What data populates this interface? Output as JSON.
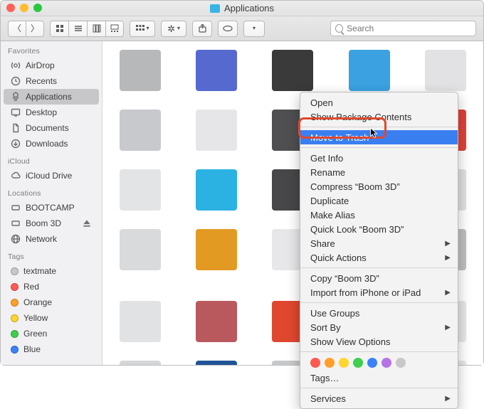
{
  "window": {
    "title": "Applications"
  },
  "search": {
    "placeholder": "Search"
  },
  "sidebar": {
    "sections": [
      {
        "header": "Favorites",
        "items": [
          {
            "label": "AirDrop"
          },
          {
            "label": "Recents"
          },
          {
            "label": "Applications"
          },
          {
            "label": "Desktop"
          },
          {
            "label": "Documents"
          },
          {
            "label": "Downloads"
          }
        ]
      },
      {
        "header": "iCloud",
        "items": [
          {
            "label": "iCloud Drive"
          }
        ]
      },
      {
        "header": "Locations",
        "items": [
          {
            "label": "BOOTCAMP"
          },
          {
            "label": "Boom 3D"
          },
          {
            "label": "Network"
          }
        ]
      },
      {
        "header": "Tags",
        "items": [
          {
            "label": "textmate",
            "color": "#c8c8c8"
          },
          {
            "label": "Red",
            "color": "#ff5a52"
          },
          {
            "label": "Orange",
            "color": "#ff9f29"
          },
          {
            "label": "Yellow",
            "color": "#ffd52e"
          },
          {
            "label": "Green",
            "color": "#3ecf4f"
          },
          {
            "label": "Blue",
            "color": "#3a82f7"
          }
        ]
      }
    ]
  },
  "selected_app": {
    "label": "Boom 3D"
  },
  "context_menu": {
    "items": [
      {
        "label": "Open"
      },
      {
        "label": "Show Package Contents"
      },
      {
        "type": "sep"
      },
      {
        "label": "Move to Trash",
        "highlighted": true
      },
      {
        "type": "sep"
      },
      {
        "label": "Get Info"
      },
      {
        "label": "Rename"
      },
      {
        "label": "Compress “Boom 3D”"
      },
      {
        "label": "Duplicate"
      },
      {
        "label": "Make Alias"
      },
      {
        "label": "Quick Look “Boom 3D”"
      },
      {
        "label": "Share",
        "submenu": true
      },
      {
        "label": "Quick Actions",
        "submenu": true
      },
      {
        "type": "sep"
      },
      {
        "label": "Copy “Boom 3D”"
      },
      {
        "label": "Import from iPhone or iPad",
        "submenu": true
      },
      {
        "type": "sep"
      },
      {
        "label": "Use Groups"
      },
      {
        "label": "Sort By",
        "submenu": true
      },
      {
        "label": "Show View Options"
      },
      {
        "type": "sep"
      },
      {
        "type": "tags",
        "colors": [
          "#ff5a52",
          "#ff9f29",
          "#ffd52e",
          "#3ecf4f",
          "#3a82f7",
          "#b673e8",
          "#c8c8c8"
        ]
      },
      {
        "label": "Tags…"
      },
      {
        "type": "sep"
      },
      {
        "label": "Services",
        "submenu": true
      }
    ]
  }
}
